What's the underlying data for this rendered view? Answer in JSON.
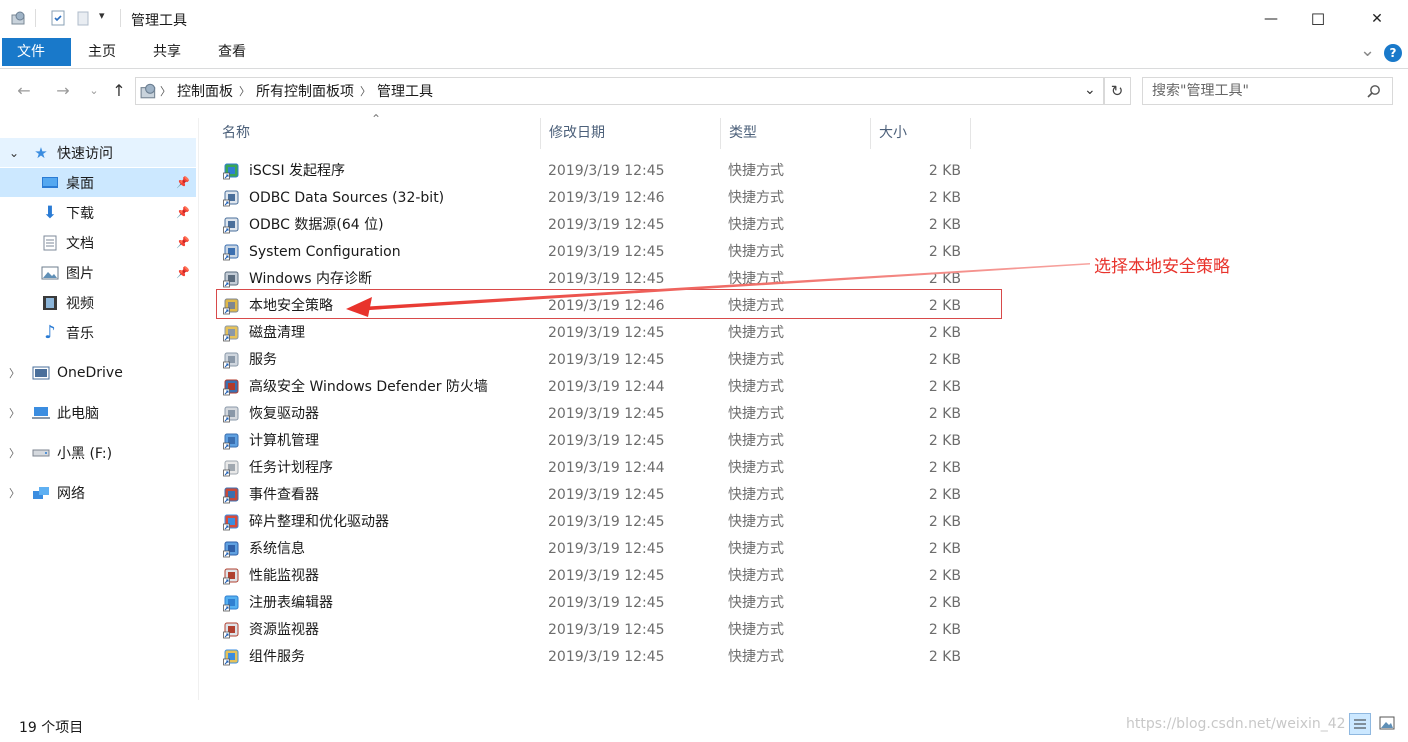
{
  "window": {
    "title": "管理工具",
    "minimize": "—",
    "maximize": "☐",
    "close": "✕"
  },
  "ribbon": {
    "tabs": [
      "文件",
      "主页",
      "共享",
      "查看"
    ],
    "expand": "⌄",
    "help": "?"
  },
  "address": {
    "crumbs": [
      "控制面板",
      "所有控制面板项",
      "管理工具"
    ],
    "dropdown": "⌄",
    "refresh": "↻",
    "search_placeholder": "搜索\"管理工具\""
  },
  "sidebar": {
    "items": [
      {
        "label": "快速访问",
        "icon": "star-icon",
        "glyph": "★",
        "color": "#3b8de0"
      },
      {
        "label": "桌面",
        "icon": "desktop-icon",
        "glyph": "▭",
        "color": "#2a7bd4",
        "pinned": true
      },
      {
        "label": "下载",
        "icon": "download-icon",
        "glyph": "⬇",
        "color": "#2a7bd4",
        "pinned": true
      },
      {
        "label": "文档",
        "icon": "document-icon",
        "glyph": "▤",
        "color": "#6e7b8b",
        "pinned": true
      },
      {
        "label": "图片",
        "icon": "picture-icon",
        "glyph": "▧",
        "color": "#5f8fb6",
        "pinned": true
      },
      {
        "label": "视频",
        "icon": "video-icon",
        "glyph": "▦",
        "color": "#444",
        "pinned": false
      },
      {
        "label": "音乐",
        "icon": "music-icon",
        "glyph": "♪",
        "color": "#2a7bd4",
        "pinned": false
      },
      {
        "label": "OneDrive",
        "icon": "onedrive-icon",
        "glyph": "▣",
        "color": "#4a6f9b"
      },
      {
        "label": "此电脑",
        "icon": "computer-icon",
        "glyph": "▬",
        "color": "#3b8de0"
      },
      {
        "label": "小黑 (F:)",
        "icon": "drive-icon",
        "glyph": "▭",
        "color": "#777"
      },
      {
        "label": "网络",
        "icon": "network-icon",
        "glyph": "◆",
        "color": "#3b8de0"
      }
    ]
  },
  "list": {
    "headers": [
      "名称",
      "修改日期",
      "类型",
      "大小"
    ],
    "sort_indicator": "⌃",
    "rows": [
      {
        "name": "iSCSI 发起程序",
        "date": "2019/3/19 12:45",
        "type": "快捷方式",
        "size": "2 KB",
        "icon": "iscsi-icon"
      },
      {
        "name": "ODBC Data Sources (32-bit)",
        "date": "2019/3/19 12:46",
        "type": "快捷方式",
        "size": "2 KB",
        "icon": "odbc-icon"
      },
      {
        "name": "ODBC 数据源(64 位)",
        "date": "2019/3/19 12:45",
        "type": "快捷方式",
        "size": "2 KB",
        "icon": "odbc-icon"
      },
      {
        "name": "System Configuration",
        "date": "2019/3/19 12:45",
        "type": "快捷方式",
        "size": "2 KB",
        "icon": "sysconfig-icon"
      },
      {
        "name": "Windows 内存诊断",
        "date": "2019/3/19 12:45",
        "type": "快捷方式",
        "size": "2 KB",
        "icon": "memory-diagnostic-icon"
      },
      {
        "name": "本地安全策略",
        "date": "2019/3/19 12:46",
        "type": "快捷方式",
        "size": "2 KB",
        "icon": "security-policy-icon"
      },
      {
        "name": "磁盘清理",
        "date": "2019/3/19 12:45",
        "type": "快捷方式",
        "size": "2 KB",
        "icon": "disk-cleanup-icon"
      },
      {
        "name": "服务",
        "date": "2019/3/19 12:45",
        "type": "快捷方式",
        "size": "2 KB",
        "icon": "services-icon"
      },
      {
        "name": "高级安全 Windows Defender 防火墙",
        "date": "2019/3/19 12:44",
        "type": "快捷方式",
        "size": "2 KB",
        "icon": "firewall-icon"
      },
      {
        "name": "恢复驱动器",
        "date": "2019/3/19 12:45",
        "type": "快捷方式",
        "size": "2 KB",
        "icon": "recovery-drive-icon"
      },
      {
        "name": "计算机管理",
        "date": "2019/3/19 12:45",
        "type": "快捷方式",
        "size": "2 KB",
        "icon": "computer-management-icon"
      },
      {
        "name": "任务计划程序",
        "date": "2019/3/19 12:44",
        "type": "快捷方式",
        "size": "2 KB",
        "icon": "task-scheduler-icon"
      },
      {
        "name": "事件查看器",
        "date": "2019/3/19 12:45",
        "type": "快捷方式",
        "size": "2 KB",
        "icon": "event-viewer-icon"
      },
      {
        "name": "碎片整理和优化驱动器",
        "date": "2019/3/19 12:45",
        "type": "快捷方式",
        "size": "2 KB",
        "icon": "defrag-icon"
      },
      {
        "name": "系统信息",
        "date": "2019/3/19 12:45",
        "type": "快捷方式",
        "size": "2 KB",
        "icon": "system-info-icon"
      },
      {
        "name": "性能监视器",
        "date": "2019/3/19 12:45",
        "type": "快捷方式",
        "size": "2 KB",
        "icon": "performance-monitor-icon"
      },
      {
        "name": "注册表编辑器",
        "date": "2019/3/19 12:45",
        "type": "快捷方式",
        "size": "2 KB",
        "icon": "registry-editor-icon"
      },
      {
        "name": "资源监视器",
        "date": "2019/3/19 12:45",
        "type": "快捷方式",
        "size": "2 KB",
        "icon": "resource-monitor-icon"
      },
      {
        "name": "组件服务",
        "date": "2019/3/19 12:45",
        "type": "快捷方式",
        "size": "2 KB",
        "icon": "component-services-icon"
      }
    ]
  },
  "status": {
    "item_count": "19 个项目"
  },
  "annotation": {
    "text": "选择本地安全策略",
    "color": "#e8332c"
  },
  "watermark": "https://blog.csdn.net/weixin_42"
}
